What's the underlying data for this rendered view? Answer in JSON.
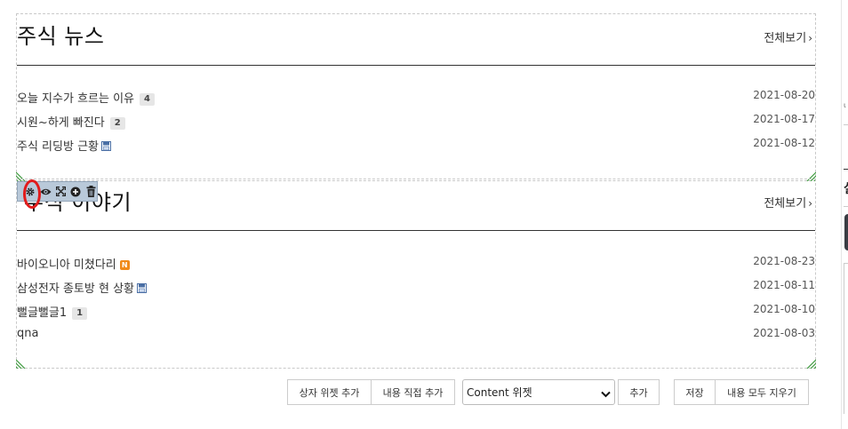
{
  "widgets": [
    {
      "title": "주식 뉴스",
      "more_label": "전체보기",
      "posts": [
        {
          "title": "오늘 지수가 흐르는 이유",
          "comments": "4",
          "date": "2021-08-20"
        },
        {
          "title": "시원~하게 빠진다",
          "comments": "2",
          "date": "2021-08-17"
        },
        {
          "title": "주식 리딩방 근황",
          "date": "2021-08-12"
        }
      ]
    },
    {
      "title": "주식 이야기",
      "more_label": "전체보기",
      "posts": [
        {
          "title": "바이오니아 미쳤다리",
          "badge": "N",
          "date": "2021-08-23"
        },
        {
          "title": "삼성전자 종토방 현 상황",
          "date": "2021-08-11"
        },
        {
          "title": "뻘글뻘글1",
          "comments": "1",
          "date": "2021-08-10"
        },
        {
          "title": "qna",
          "date": "2021-08-03"
        }
      ]
    }
  ],
  "toolbar": {
    "icons": [
      "gear-icon",
      "eye-icon",
      "expand-icon",
      "plus-circle-icon",
      "trash-icon"
    ]
  },
  "actions": {
    "add_box_widget": "상자 위젯 추가",
    "add_content_direct": "내용 직접 추가",
    "widget_select": "Content 위젯",
    "add": "추가",
    "save": "저장",
    "clear_all": "내용 모두 지우기"
  },
  "right_panel": {
    "fragment_text_1": "ι",
    "fragment_text_2": "실"
  },
  "colors": {
    "accent_badge": "#f08a1a",
    "highlight_ring": "#e21b1b",
    "toolbar_bg": "#b9c9d9",
    "corner_mark": "#3d9a3d"
  }
}
